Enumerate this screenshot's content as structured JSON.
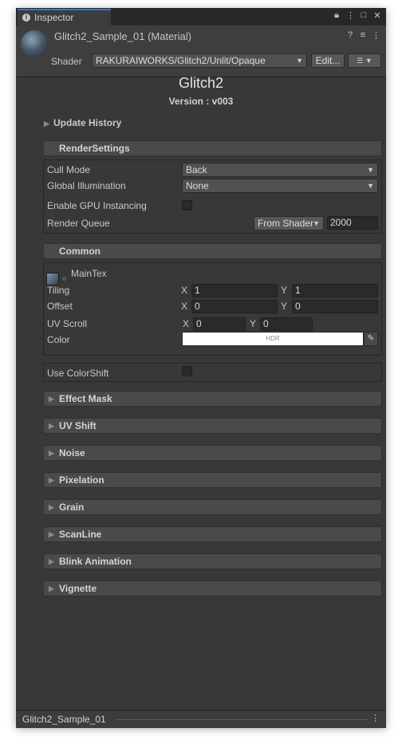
{
  "window": {
    "tab_label": "Inspector",
    "icons": [
      "lock-icon",
      "more-vert-icon",
      "maximize-icon",
      "close-icon"
    ]
  },
  "header": {
    "material_title": "Glitch2_Sample_01 (Material)",
    "shader_label": "Shader",
    "shader_value": "RAKURAIWORKS/Glitch2/Unlit/Opaque",
    "edit_label": "Edit...",
    "icons": [
      "help-icon",
      "settings-sliders-icon",
      "more-vert-icon"
    ]
  },
  "title": {
    "main": "Glitch2",
    "version": "Version : v003"
  },
  "update_history": "Update History",
  "render_settings": {
    "header": "RenderSettings",
    "cull_mode_label": "Cull Mode",
    "cull_mode_value": "Back",
    "gi_label": "Global Illumination",
    "gi_value": "None",
    "gpu_instancing_label": "Enable GPU Instancing",
    "gpu_instancing_checked": false,
    "render_queue_label": "Render Queue",
    "render_queue_source": "From Shader",
    "render_queue_value": "2000"
  },
  "common": {
    "header": "Common",
    "main_tex_label": "MainTex",
    "tiling_label": "Tiling",
    "tiling_x": "1",
    "tiling_y": "1",
    "offset_label": "Offset",
    "offset_x": "0",
    "offset_y": "0",
    "uv_scroll_label": "UV Scroll",
    "uv_scroll_x": "0",
    "uv_scroll_y": "0",
    "color_label": "Color",
    "color_hdr": "HDR",
    "color_value": "#ffffff",
    "axis_x": "X",
    "axis_y": "Y"
  },
  "use_color_shift": {
    "label": "Use ColorShift",
    "checked": false
  },
  "sections": [
    "Effect Mask",
    "UV Shift",
    "Noise",
    "Pixelation",
    "Grain",
    "ScanLine",
    "Blink Animation",
    "Vignette"
  ],
  "status": {
    "label": "Glitch2_Sample_01"
  },
  "colors": {
    "accent": "#3a79bb",
    "panel": "#383838",
    "section_header": "#4a4a4a"
  }
}
